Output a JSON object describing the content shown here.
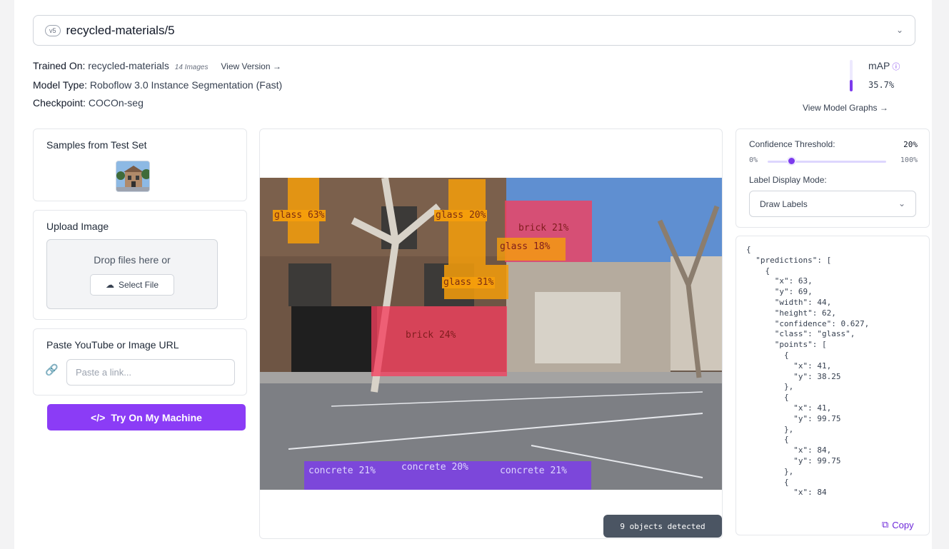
{
  "model": {
    "version_badge": "v5",
    "version_name": "recycled-materials/5",
    "trained_on_label": "Trained On:",
    "trained_on_value": "recycled-materials",
    "images_count": "14 Images",
    "view_version": "View Version →",
    "model_type_label": "Model Type:",
    "model_type_value": "Roboflow 3.0 Instance Segmentation (Fast)",
    "checkpoint_label": "Checkpoint:",
    "checkpoint_value": "COCOn-seg",
    "map_label": "mAP",
    "map_value": "35.7%",
    "map_fraction": 0.357,
    "view_graphs": "View Model Graphs →"
  },
  "samples": {
    "title": "Samples from Test Set"
  },
  "upload": {
    "title": "Upload Image",
    "drop_text": "Drop files here or",
    "select_label": "Select File"
  },
  "url_card": {
    "title": "Paste YouTube or Image URL",
    "placeholder": "Paste a link..."
  },
  "try_button": {
    "label": "Try On My Machine"
  },
  "preview": {
    "detections": [
      {
        "label": "glass 63%",
        "kind": "glass"
      },
      {
        "label": "glass 20%",
        "kind": "glass"
      },
      {
        "label": "brick 21%",
        "kind": "brick"
      },
      {
        "label": "glass 18%",
        "kind": "glass"
      },
      {
        "label": "glass 31%",
        "kind": "glass"
      },
      {
        "label": "brick 24%",
        "kind": "brick"
      },
      {
        "label": "concrete 21%",
        "kind": "concrete"
      },
      {
        "label": "concrete 20%",
        "kind": "concrete"
      },
      {
        "label": "concrete 21%",
        "kind": "concrete"
      }
    ],
    "objects_detected": "9 objects detected"
  },
  "settings": {
    "confidence_label": "Confidence Threshold:",
    "confidence_value": "20%",
    "confidence_fraction": 0.2,
    "min_label": "0%",
    "max_label": "100%",
    "display_mode_label": "Label Display Mode:",
    "display_mode_value": "Draw Labels"
  },
  "json_output": {
    "text": "{\n  \"predictions\": [\n    {\n      \"x\": 63,\n      \"y\": 69,\n      \"width\": 44,\n      \"height\": 62,\n      \"confidence\": 0.627,\n      \"class\": \"glass\",\n      \"points\": [\n        {\n          \"x\": 41,\n          \"y\": 38.25\n        },\n        {\n          \"x\": 41,\n          \"y\": 99.75\n        },\n        {\n          \"x\": 84,\n          \"y\": 99.75\n        },\n        {\n          \"x\": 84",
    "copy_label": "Copy"
  },
  "colors": {
    "accent": "#8b3cf6",
    "glass": "#f59e0b",
    "brick": "#f43f5e",
    "concrete": "#7c3aed"
  }
}
